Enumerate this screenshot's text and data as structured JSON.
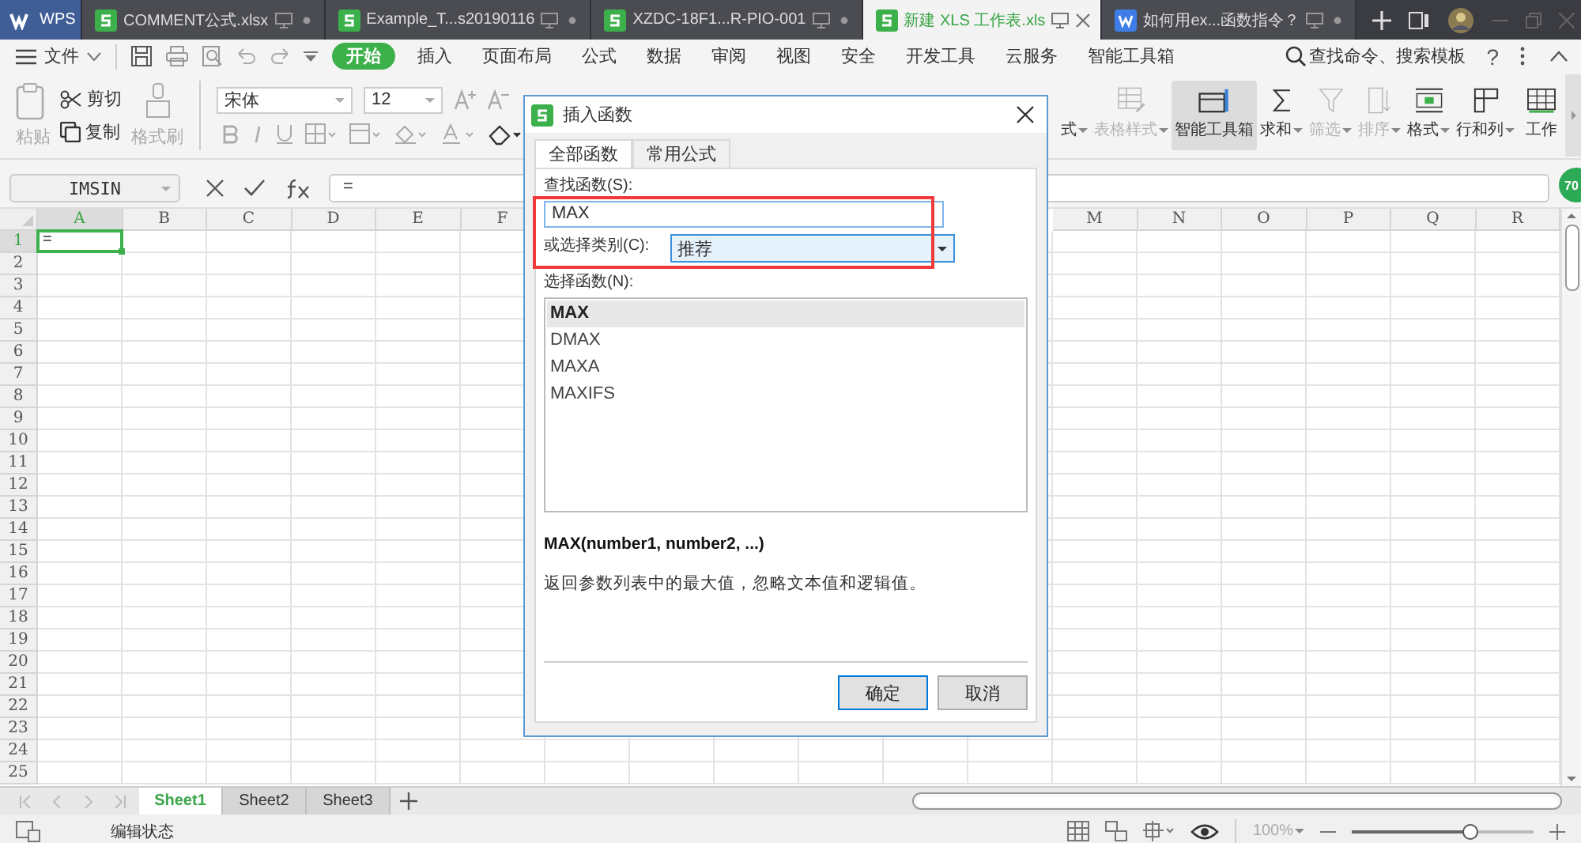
{
  "tabs": [
    {
      "label": "WPS",
      "kind": "home",
      "selected": false
    },
    {
      "label": "COMMENT公式.xlsx",
      "kind": "sheet",
      "selected": false
    },
    {
      "label": "Example_T...s20190116",
      "kind": "sheet",
      "selected": false
    },
    {
      "label": "XZDC-18F1...R-PIO-001",
      "kind": "sheet",
      "selected": false
    },
    {
      "label": "新建 XLS 工作表.xls",
      "kind": "sheet",
      "selected": true
    },
    {
      "label": "如何用ex...函数指令？",
      "kind": "doc",
      "selected": false
    }
  ],
  "menu": {
    "file": "文件",
    "tabs": [
      {
        "label": "开始",
        "selected": true
      },
      {
        "label": "插入",
        "selected": false
      },
      {
        "label": "页面布局",
        "selected": false
      },
      {
        "label": "公式",
        "selected": false
      },
      {
        "label": "数据",
        "selected": false
      },
      {
        "label": "审阅",
        "selected": false
      },
      {
        "label": "视图",
        "selected": false
      },
      {
        "label": "安全",
        "selected": false
      },
      {
        "label": "开发工具",
        "selected": false
      },
      {
        "label": "云服务",
        "selected": false
      },
      {
        "label": "智能工具箱",
        "selected": false
      }
    ],
    "search": "查找命令、搜索模板",
    "help": "?"
  },
  "ribbon": {
    "paste": {
      "label": "粘贴",
      "disabled": true
    },
    "small": [
      {
        "label": "剪切",
        "kind": "cut"
      },
      {
        "label": "复制",
        "kind": "copy"
      }
    ],
    "brush": {
      "label": "格式刷",
      "disabled": true
    },
    "font": "宋体",
    "size": "12",
    "right": [
      {
        "label": "式",
        "kind": "plain",
        "disabled": false,
        "selected": false
      },
      {
        "label": "表格样式",
        "kind": "table-style",
        "disabled": true,
        "selected": false
      },
      {
        "label": "智能工具箱",
        "kind": "toolbox",
        "disabled": false,
        "selected": true
      },
      {
        "label": "求和",
        "kind": "sum",
        "disabled": false,
        "selected": false
      },
      {
        "label": "筛选",
        "kind": "filter",
        "disabled": true,
        "selected": false
      },
      {
        "label": "排序",
        "kind": "sort",
        "disabled": true,
        "selected": false
      },
      {
        "label": "格式",
        "kind": "format",
        "disabled": false,
        "selected": false
      },
      {
        "label": "行和列",
        "kind": "rows",
        "disabled": false,
        "selected": false
      },
      {
        "label": "工作",
        "kind": "sheet",
        "disabled": false,
        "selected": false
      }
    ]
  },
  "formula_bar": {
    "name_box": "IMSIN",
    "value": "=",
    "badge": "70"
  },
  "sheet": {
    "columns_left": [
      {
        "label": "A",
        "selected": true
      },
      {
        "label": "B",
        "selected": false
      },
      {
        "label": "C",
        "selected": false
      },
      {
        "label": "D",
        "selected": false
      },
      {
        "label": "E",
        "selected": false
      },
      {
        "label": "F",
        "selected": false
      }
    ],
    "columns_right": [
      {
        "label": "M",
        "selected": false
      },
      {
        "label": "N",
        "selected": false
      },
      {
        "label": "O",
        "selected": false
      },
      {
        "label": "P",
        "selected": false
      },
      {
        "label": "Q",
        "selected": false
      },
      {
        "label": "R",
        "selected": false
      }
    ],
    "rows": [
      {
        "label": "1",
        "selected": true
      },
      {
        "label": "2",
        "selected": false
      },
      {
        "label": "3",
        "selected": false
      },
      {
        "label": "4",
        "selected": false
      },
      {
        "label": "5",
        "selected": false
      },
      {
        "label": "6",
        "selected": false
      },
      {
        "label": "7",
        "selected": false
      },
      {
        "label": "8",
        "selected": false
      },
      {
        "label": "9",
        "selected": false
      },
      {
        "label": "10",
        "selected": false
      },
      {
        "label": "11",
        "selected": false
      },
      {
        "label": "12",
        "selected": false
      },
      {
        "label": "13",
        "selected": false
      },
      {
        "label": "14",
        "selected": false
      },
      {
        "label": "15",
        "selected": false
      },
      {
        "label": "16",
        "selected": false
      },
      {
        "label": "17",
        "selected": false
      },
      {
        "label": "18",
        "selected": false
      },
      {
        "label": "19",
        "selected": false
      },
      {
        "label": "20",
        "selected": false
      },
      {
        "label": "21",
        "selected": false
      },
      {
        "label": "22",
        "selected": false
      },
      {
        "label": "23",
        "selected": false
      },
      {
        "label": "24",
        "selected": false
      },
      {
        "label": "25",
        "selected": false
      }
    ],
    "active_cell_value": "="
  },
  "sheet_tabs": [
    {
      "label": "Sheet1",
      "selected": true
    },
    {
      "label": "Sheet2",
      "selected": false
    },
    {
      "label": "Sheet3",
      "selected": false
    }
  ],
  "status_bar": {
    "mode": "编辑状态",
    "zoom": "100%",
    "level": 0.65
  },
  "dialog": {
    "title": "插入函数",
    "tabs": [
      {
        "label": "全部函数",
        "selected": true
      },
      {
        "label": "常用公式",
        "selected": false
      }
    ],
    "search_label": "查找函数(S):",
    "search_value": "MAX",
    "category_label": "或选择类别(C):",
    "category": "推荐",
    "list_label": "选择函数(N):",
    "functions": [
      {
        "name": "MAX",
        "selected": true
      },
      {
        "name": "DMAX",
        "selected": false
      },
      {
        "name": "MAXA",
        "selected": false
      },
      {
        "name": "MAXIFS",
        "selected": false
      }
    ],
    "signature": "MAX(number1, number2, ...)",
    "description": "返回参数列表中的最大值，忽略文本值和逻辑值。",
    "buttons": [
      {
        "label": "确定",
        "kind": "primary"
      },
      {
        "label": "取消",
        "kind": "secondary"
      }
    ]
  }
}
